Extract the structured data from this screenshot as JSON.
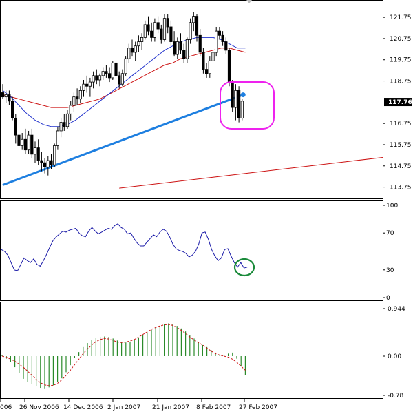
{
  "chart_data": [
    {
      "type": "candlestick",
      "panel": "price",
      "ylim": [
        113.25,
        122.5
      ],
      "y_ticks": [
        "121.75",
        "120.75",
        "119.75",
        "118.75",
        "117.76",
        "116.75",
        "115.75",
        "114.75",
        "113.75"
      ],
      "last_price": "117.76",
      "colors": {
        "candle": "#000000",
        "ma_fast": "#2233cc",
        "ma_slow": "#cc1111",
        "trendline": "#1e7fe0",
        "channel_line": "#cc1111",
        "highlight_box": "#ee22ee",
        "price_box": "#000000"
      },
      "candles": [
        {
          "o": 118.2,
          "h": 118.6,
          "l": 117.9,
          "c": 118.0
        },
        {
          "o": 118.0,
          "h": 118.3,
          "l": 117.7,
          "c": 118.1
        },
        {
          "o": 118.1,
          "h": 118.3,
          "l": 117.6,
          "c": 117.8
        },
        {
          "o": 117.8,
          "h": 118.0,
          "l": 116.9,
          "c": 117.0
        },
        {
          "o": 117.0,
          "h": 117.2,
          "l": 115.8,
          "c": 116.2
        },
        {
          "o": 116.2,
          "h": 116.6,
          "l": 115.4,
          "c": 115.7
        },
        {
          "o": 115.7,
          "h": 116.3,
          "l": 115.5,
          "c": 116.0
        },
        {
          "o": 116.0,
          "h": 116.5,
          "l": 115.3,
          "c": 115.5
        },
        {
          "o": 115.5,
          "h": 116.4,
          "l": 115.3,
          "c": 116.2
        },
        {
          "o": 116.2,
          "h": 116.5,
          "l": 115.1,
          "c": 115.3
        },
        {
          "o": 115.3,
          "h": 115.9,
          "l": 114.9,
          "c": 115.6
        },
        {
          "o": 115.6,
          "h": 116.0,
          "l": 114.8,
          "c": 115.0
        },
        {
          "o": 115.0,
          "h": 115.4,
          "l": 114.5,
          "c": 114.9
        },
        {
          "o": 114.9,
          "h": 115.1,
          "l": 114.4,
          "c": 114.7
        },
        {
          "o": 114.7,
          "h": 115.2,
          "l": 114.3,
          "c": 115.0
        },
        {
          "o": 115.0,
          "h": 115.3,
          "l": 114.6,
          "c": 114.8
        },
        {
          "o": 114.8,
          "h": 115.8,
          "l": 114.7,
          "c": 115.7
        },
        {
          "o": 115.7,
          "h": 116.6,
          "l": 115.5,
          "c": 116.4
        },
        {
          "o": 116.4,
          "h": 117.0,
          "l": 116.1,
          "c": 116.8
        },
        {
          "o": 116.8,
          "h": 117.2,
          "l": 116.4,
          "c": 116.6
        },
        {
          "o": 116.6,
          "h": 117.4,
          "l": 116.5,
          "c": 117.2
        },
        {
          "o": 117.2,
          "h": 117.8,
          "l": 116.9,
          "c": 117.6
        },
        {
          "o": 117.6,
          "h": 118.2,
          "l": 117.3,
          "c": 118.0
        },
        {
          "o": 118.0,
          "h": 118.4,
          "l": 117.6,
          "c": 117.9
        },
        {
          "o": 117.9,
          "h": 118.5,
          "l": 117.7,
          "c": 118.3
        },
        {
          "o": 118.3,
          "h": 118.8,
          "l": 118.0,
          "c": 118.6
        },
        {
          "o": 118.6,
          "h": 119.0,
          "l": 118.2,
          "c": 118.5
        },
        {
          "o": 118.5,
          "h": 118.9,
          "l": 118.0,
          "c": 118.7
        },
        {
          "o": 118.7,
          "h": 119.2,
          "l": 118.4,
          "c": 119.0
        },
        {
          "o": 119.0,
          "h": 119.3,
          "l": 118.6,
          "c": 118.8
        },
        {
          "o": 118.8,
          "h": 119.1,
          "l": 118.5,
          "c": 119.0
        },
        {
          "o": 119.0,
          "h": 119.4,
          "l": 118.8,
          "c": 119.2
        },
        {
          "o": 119.2,
          "h": 119.5,
          "l": 118.9,
          "c": 119.1
        },
        {
          "o": 119.1,
          "h": 119.4,
          "l": 118.7,
          "c": 118.9
        },
        {
          "o": 118.9,
          "h": 119.7,
          "l": 118.8,
          "c": 119.6
        },
        {
          "o": 119.6,
          "h": 119.8,
          "l": 118.9,
          "c": 119.0
        },
        {
          "o": 119.0,
          "h": 119.2,
          "l": 118.4,
          "c": 118.6
        },
        {
          "o": 118.6,
          "h": 119.3,
          "l": 118.5,
          "c": 119.1
        },
        {
          "o": 119.1,
          "h": 119.9,
          "l": 119.0,
          "c": 119.8
        },
        {
          "o": 119.8,
          "h": 120.5,
          "l": 119.6,
          "c": 120.3
        },
        {
          "o": 120.3,
          "h": 120.7,
          "l": 119.9,
          "c": 120.1
        },
        {
          "o": 120.1,
          "h": 120.6,
          "l": 119.7,
          "c": 120.4
        },
        {
          "o": 120.4,
          "h": 120.9,
          "l": 120.1,
          "c": 120.6
        },
        {
          "o": 120.6,
          "h": 121.0,
          "l": 120.2,
          "c": 120.8
        },
        {
          "o": 120.8,
          "h": 121.6,
          "l": 120.7,
          "c": 121.4
        },
        {
          "o": 121.4,
          "h": 121.8,
          "l": 120.9,
          "c": 121.1
        },
        {
          "o": 121.1,
          "h": 121.5,
          "l": 120.6,
          "c": 120.8
        },
        {
          "o": 120.8,
          "h": 121.7,
          "l": 120.6,
          "c": 121.5
        },
        {
          "o": 121.5,
          "h": 121.8,
          "l": 121.0,
          "c": 121.2
        },
        {
          "o": 121.2,
          "h": 121.4,
          "l": 120.5,
          "c": 120.7
        },
        {
          "o": 120.7,
          "h": 121.9,
          "l": 120.6,
          "c": 121.7
        },
        {
          "o": 121.7,
          "h": 121.9,
          "l": 121.0,
          "c": 121.3
        },
        {
          "o": 121.3,
          "h": 121.6,
          "l": 120.4,
          "c": 120.6
        },
        {
          "o": 120.6,
          "h": 121.1,
          "l": 119.9,
          "c": 120.0
        },
        {
          "o": 120.0,
          "h": 120.8,
          "l": 119.8,
          "c": 120.6
        },
        {
          "o": 120.6,
          "h": 121.0,
          "l": 120.0,
          "c": 120.2
        },
        {
          "o": 120.2,
          "h": 120.5,
          "l": 119.6,
          "c": 119.8
        },
        {
          "o": 119.8,
          "h": 120.8,
          "l": 119.6,
          "c": 120.7
        },
        {
          "o": 120.7,
          "h": 121.7,
          "l": 120.5,
          "c": 121.5
        },
        {
          "o": 121.5,
          "h": 122.0,
          "l": 121.1,
          "c": 121.8
        },
        {
          "o": 121.8,
          "h": 121.9,
          "l": 120.6,
          "c": 120.9
        },
        {
          "o": 120.9,
          "h": 121.2,
          "l": 119.9,
          "c": 120.1
        },
        {
          "o": 120.1,
          "h": 120.3,
          "l": 119.1,
          "c": 119.3
        },
        {
          "o": 119.3,
          "h": 119.6,
          "l": 118.9,
          "c": 119.1
        },
        {
          "o": 119.1,
          "h": 119.9,
          "l": 118.9,
          "c": 119.7
        },
        {
          "o": 119.7,
          "h": 120.3,
          "l": 119.5,
          "c": 120.1
        },
        {
          "o": 120.1,
          "h": 121.3,
          "l": 119.9,
          "c": 121.1
        },
        {
          "o": 121.1,
          "h": 121.3,
          "l": 120.7,
          "c": 120.9
        },
        {
          "o": 120.9,
          "h": 121.1,
          "l": 120.4,
          "c": 120.6
        },
        {
          "o": 120.6,
          "h": 120.8,
          "l": 120.0,
          "c": 120.2
        },
        {
          "o": 120.2,
          "h": 120.3,
          "l": 118.5,
          "c": 118.7
        },
        {
          "o": 118.7,
          "h": 118.8,
          "l": 117.3,
          "c": 117.5
        },
        {
          "o": 117.5,
          "h": 118.6,
          "l": 116.9,
          "c": 118.3
        },
        {
          "o": 118.3,
          "h": 118.5,
          "l": 116.8,
          "c": 117.0
        },
        {
          "o": 117.0,
          "h": 117.9,
          "l": 116.9,
          "c": 117.8
        }
      ],
      "ma_fast": [
        118.3,
        118.0,
        117.6,
        117.2,
        116.9,
        116.7,
        116.6,
        116.6,
        116.7,
        116.9,
        117.2,
        117.5,
        117.8,
        118.1,
        118.4,
        118.7,
        119.0,
        119.3,
        119.6,
        119.9,
        120.2,
        120.4,
        120.6,
        120.7,
        120.8,
        120.8,
        120.8,
        120.7,
        120.5,
        120.3,
        120.3
      ],
      "ma_slow": [
        118.1,
        118.0,
        117.9,
        117.8,
        117.7,
        117.6,
        117.5,
        117.5,
        117.5,
        117.6,
        117.7,
        117.8,
        117.9,
        118.1,
        118.3,
        118.5,
        118.7,
        118.9,
        119.1,
        119.3,
        119.5,
        119.6,
        119.8,
        119.9,
        120.0,
        120.1,
        120.2,
        120.3,
        120.3,
        120.2,
        120.1
      ],
      "trendline": {
        "from": {
          "i": 0,
          "y": 113.85
        },
        "to": {
          "i": 74.3,
          "y": 118.1
        }
      },
      "channel_line": {
        "from": {
          "i": 36,
          "y": 113.7
        },
        "to": {
          "i": 77,
          "y": 115.15
        }
      }
    },
    {
      "type": "line",
      "panel": "oscillator",
      "ylim": [
        0,
        100
      ],
      "y_ticks": [
        "100",
        "70",
        "30",
        "0"
      ],
      "values": [
        52,
        50,
        46,
        38,
        30,
        29,
        36,
        43,
        40,
        38,
        42,
        36,
        34,
        40,
        47,
        55,
        62,
        66,
        69,
        72,
        71,
        73,
        74,
        75,
        70,
        67,
        66,
        72,
        76,
        72,
        69,
        71,
        73,
        75,
        74,
        78,
        80,
        76,
        74,
        69,
        70,
        64,
        59,
        56,
        56,
        60,
        64,
        68,
        66,
        71,
        74,
        72,
        66,
        58,
        53,
        51,
        50,
        48,
        44,
        46,
        50,
        58,
        70,
        71,
        63,
        52,
        45,
        40,
        43,
        52,
        53,
        45,
        38,
        33,
        38,
        32,
        33
      ]
    },
    {
      "type": "bar",
      "panel": "macd",
      "ylim": [
        -0.78,
        0.944
      ],
      "y_ticks": [
        "0.944",
        "0.00",
        "-0.78"
      ],
      "x_ticks": [
        "006",
        "26 Nov 2006",
        "14 Dec 2006",
        "2 Jan 2007",
        "21 Jan 2007",
        "8 Feb 2007",
        "27 Feb 2007"
      ],
      "histogram": [
        0.02,
        -0.05,
        -0.12,
        -0.22,
        -0.33,
        -0.45,
        -0.52,
        -0.56,
        -0.6,
        -0.63,
        -0.64,
        -0.62,
        -0.58,
        -0.52,
        -0.44,
        -0.32,
        -0.18,
        -0.04,
        0.08,
        0.18,
        0.26,
        0.32,
        0.36,
        0.38,
        0.39,
        0.38,
        0.35,
        0.31,
        0.28,
        0.27,
        0.28,
        0.32,
        0.37,
        0.42,
        0.47,
        0.52,
        0.56,
        0.6,
        0.63,
        0.65,
        0.64,
        0.6,
        0.55,
        0.49,
        0.42,
        0.35,
        0.28,
        0.22,
        0.18,
        0.12,
        0.07,
        0.03,
        0.02,
        0.05,
        0.07,
        -0.05,
        -0.2,
        -0.38
      ],
      "signal": [
        0.0,
        -0.02,
        -0.06,
        -0.1,
        -0.16,
        -0.22,
        -0.3,
        -0.38,
        -0.46,
        -0.53,
        -0.57,
        -0.59,
        -0.58,
        -0.54,
        -0.47,
        -0.38,
        -0.28,
        -0.17,
        -0.06,
        0.05,
        0.14,
        0.22,
        0.29,
        0.33,
        0.35,
        0.34,
        0.31,
        0.28,
        0.27,
        0.28,
        0.3,
        0.33,
        0.38,
        0.43,
        0.48,
        0.53,
        0.57,
        0.6,
        0.62,
        0.63,
        0.61,
        0.57,
        0.51,
        0.45,
        0.38,
        0.32,
        0.27,
        0.22,
        0.16,
        0.1,
        0.05,
        0.02,
        0.0,
        -0.02,
        -0.06,
        -0.12,
        -0.2,
        -0.28
      ]
    }
  ]
}
